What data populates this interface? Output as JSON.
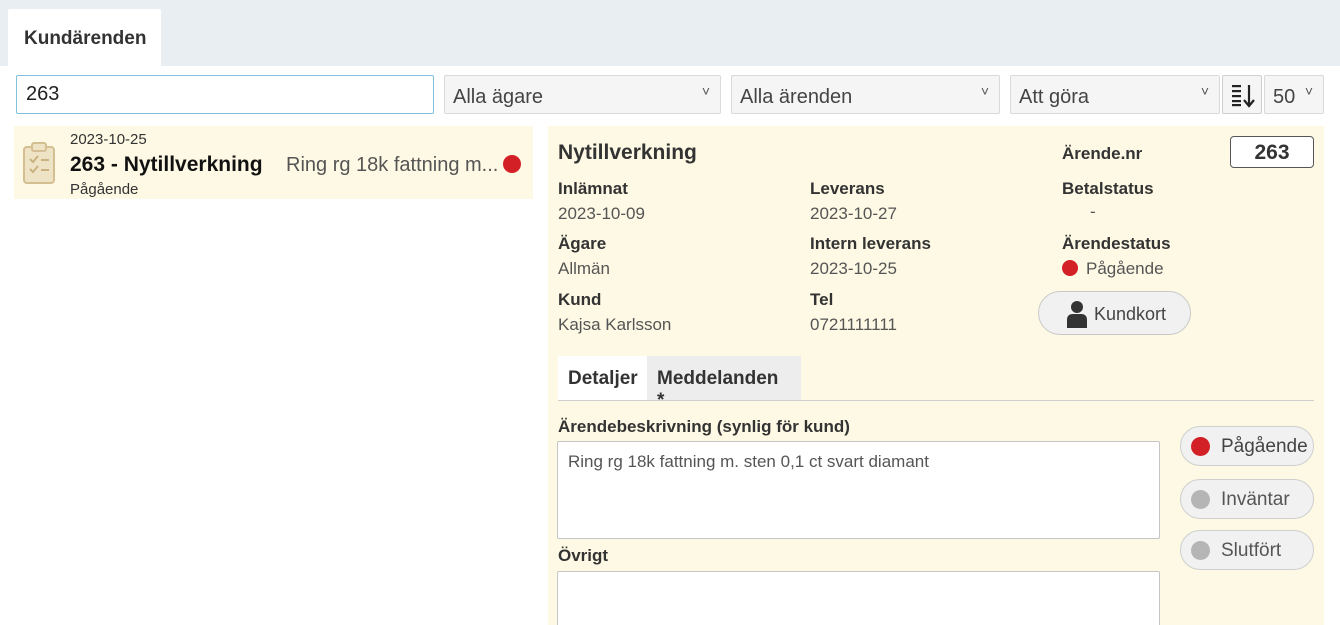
{
  "app": {
    "tab_label": "Kundärenden"
  },
  "toolbar": {
    "search_value": "263",
    "owner_filter": "Alla ägare",
    "errand_filter": "Alla ärenden",
    "todo_filter": "Att göra",
    "page_size": "50",
    "chevron": "˅",
    "sort_icon": "sort-descending-icon"
  },
  "list": {
    "items": [
      {
        "date": "2023-10-25",
        "title": "263 - Nytillverkning",
        "description": "Ring rg 18k fattning m...",
        "status": "Pågående",
        "status_color": "#d31f26",
        "icon": "clipboard-check-icon"
      }
    ]
  },
  "detail": {
    "title": "Nytillverkning",
    "number_label": "Ärende.nr",
    "number": "263",
    "fields": {
      "submitted_label": "Inlämnat",
      "submitted": "2023-10-09",
      "delivery_label": "Leverans",
      "delivery": "2023-10-27",
      "payment_label": "Betalstatus",
      "payment": "-",
      "owner_label": "Ägare",
      "owner": "Allmän",
      "internal_delivery_label": "Intern leverans",
      "internal_delivery": "2023-10-25",
      "errand_status_label": "Ärendestatus",
      "errand_status": "Pågående",
      "customer_label": "Kund",
      "customer": "Kajsa Karlsson",
      "phone_label": "Tel",
      "phone": "0721111111"
    },
    "customer_card_button": "Kundkort",
    "tabs": [
      "Detaljer",
      "Meddelanden *"
    ],
    "description_label": "Ärendebeskrivning (synlig för kund)",
    "description": "Ring rg 18k fattning m. sten 0,1 ct svart diamant",
    "other_label": "Övrigt",
    "other": "",
    "status_buttons": [
      {
        "label": "Pågående",
        "color": "#d31f26"
      },
      {
        "label": "Inväntar",
        "color": "#b5b5b5"
      },
      {
        "label": "Slutfört",
        "color": "#b5b5b5"
      }
    ]
  }
}
